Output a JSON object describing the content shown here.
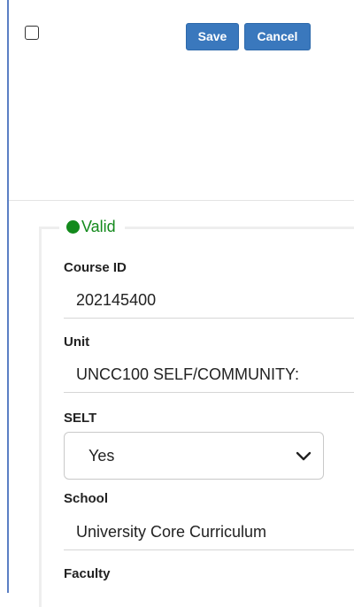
{
  "toolbar": {
    "save_label": "Save",
    "cancel_label": "Cancel"
  },
  "status": {
    "label": "Valid",
    "color": "#138a1c"
  },
  "fields": {
    "course_id": {
      "label": "Course ID",
      "value": "202145400"
    },
    "unit": {
      "label": "Unit",
      "value": "UNCC100 SELF/COMMUNITY:"
    },
    "selt": {
      "label": "SELT",
      "selected": "Yes"
    },
    "school": {
      "label": "School",
      "value": "University Core Curriculum"
    },
    "faculty": {
      "label": "Faculty"
    }
  },
  "colors": {
    "accent": "#3a78bd",
    "frame": "#5b7fc4"
  }
}
